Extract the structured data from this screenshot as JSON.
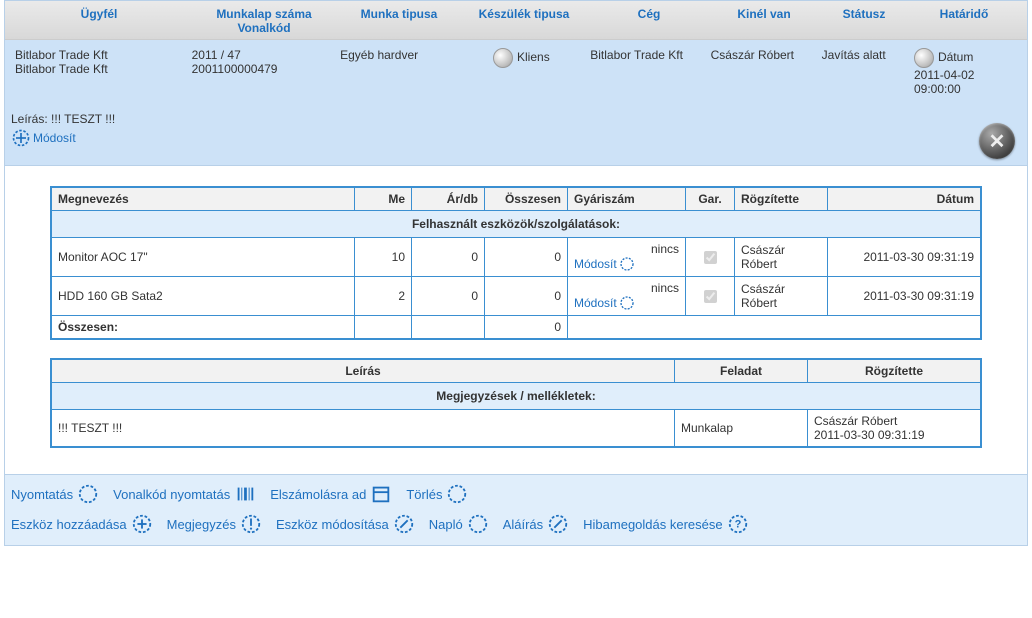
{
  "header": {
    "c1": "Ügyfél",
    "c2a": "Munkalap száma",
    "c2b": "Vonalkód",
    "c3": "Munka tipusa",
    "c4": "Készülék tipusa",
    "c5": "Cég",
    "c6": "Kinél van",
    "c7": "Státusz",
    "c8": "Határidő"
  },
  "info": {
    "client_line1": "Bitlabor Trade Kft",
    "client_line2": "Bitlabor Trade Kft",
    "sheet_no": "2011 / 47",
    "barcode": "2001100000479",
    "work_type": "Egyéb hardver",
    "device_type": "Kliens",
    "company": "Bitlabor Trade Kft",
    "who": "Császár Róbert",
    "status": "Javítás alatt",
    "deadline_label": "Dátum",
    "deadline": "2011-04-02 09:00:00",
    "desc_label": "Leírás: !!! TESZT !!!",
    "modify": "Módosít"
  },
  "tools": {
    "title": "Felhasznált eszközök/szolgálatások:",
    "head": {
      "name": "Megnevezés",
      "me": "Me",
      "unit": "Ár/db",
      "total": "Összesen",
      "serial": "Gyáriszám",
      "gar": "Gar.",
      "recorded": "Rögzítette",
      "date": "Dátum"
    },
    "rows": [
      {
        "name": "Monitor AOC 17\"",
        "me": "10",
        "unit": "0",
        "total": "0",
        "serial": "nincs",
        "gar": true,
        "rec": "Császár Róbert",
        "date": "2011-03-30 09:31:19"
      },
      {
        "name": "HDD 160 GB Sata2",
        "me": "2",
        "unit": "0",
        "total": "0",
        "serial": "nincs",
        "gar": true,
        "rec": "Császár Róbert",
        "date": "2011-03-30 09:31:19"
      }
    ],
    "sum_label": "Összesen:",
    "sum_value": "0",
    "modify": "Módosít"
  },
  "notes": {
    "title": "Megjegyzések / mellékletek:",
    "head": {
      "desc": "Leírás",
      "task": "Feladat",
      "rec": "Rögzítette"
    },
    "rows": [
      {
        "desc": "!!! TESZT !!!",
        "task": "Munkalap",
        "rec": "Császár Róbert",
        "date": "2011-03-30 09:31:19"
      }
    ]
  },
  "actions": {
    "print": "Nyomtatás",
    "barcode_print": "Vonalkód nyomtatás",
    "settle": "Elszámolásra ad",
    "delete": "Törlés",
    "add_tool": "Eszköz hozzáadása",
    "comment": "Megjegyzés",
    "modify_tool": "Eszköz módosítása",
    "log": "Napló",
    "signature": "Aláírás",
    "search": "Hibamegoldás keresése"
  }
}
